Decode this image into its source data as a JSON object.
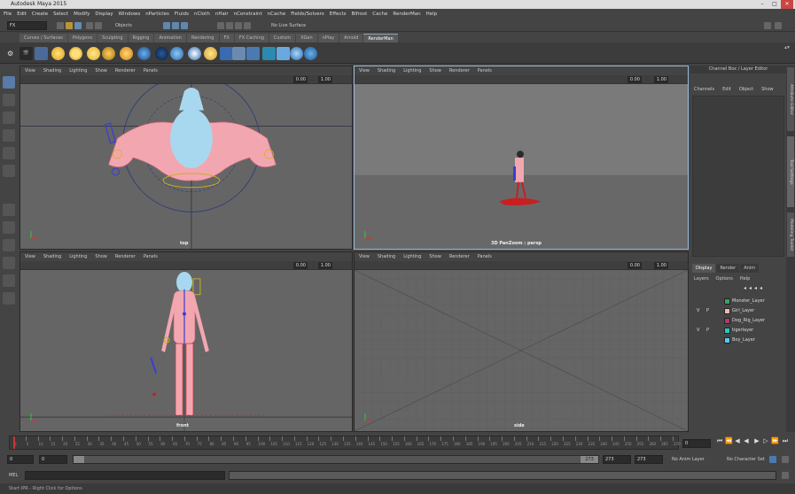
{
  "window": {
    "title": "Autodesk Maya 2015"
  },
  "menu": [
    "File",
    "Edit",
    "Create",
    "Select",
    "Modify",
    "Display",
    "Windows",
    "nParticles",
    "Fluids",
    "nCloth",
    "nHair",
    "nConstraint",
    "nCache",
    "Fields/Solvers",
    "Effects",
    "Bifrost",
    "Cache",
    "RenderMan",
    "Help"
  ],
  "status": {
    "mode": "FX",
    "objects": "Objects",
    "live": "No Live Surface"
  },
  "shelf_tabs": [
    "Curves / Surfaces",
    "Polygons",
    "Sculpting",
    "Rigging",
    "Animation",
    "Rendering",
    "FX",
    "FX Caching",
    "Custom",
    "XGen",
    "nPlay",
    "Arnold",
    "RenderMan"
  ],
  "shelf_active": "RenderMan",
  "viewport_menu": [
    "View",
    "Shading",
    "Lighting",
    "Show",
    "Renderer",
    "Panels"
  ],
  "viewports": {
    "top": {
      "label": "top",
      "near": "0.00",
      "far": "1.00"
    },
    "persp": {
      "label": "3D PanZoom : persp",
      "near": "0.00",
      "far": "1.00"
    },
    "front": {
      "label": "front",
      "near": "0.00",
      "far": "1.00"
    },
    "side": {
      "label": "side",
      "near": "0.00",
      "far": "1.00"
    }
  },
  "channel_box": {
    "title": "Channel Box / Layer Editor",
    "menu": [
      "Channels",
      "Edit",
      "Object",
      "Show"
    ]
  },
  "layer_editor": {
    "tabs": [
      "Display",
      "Render",
      "Anim"
    ],
    "menu": [
      "Layers",
      "Options",
      "Help"
    ],
    "layers": [
      {
        "vis": "",
        "p": "",
        "name": "Monster_Layer",
        "color": "#3aa06a"
      },
      {
        "vis": "V",
        "p": "P",
        "name": "Girl_Layer",
        "color": "#f2b6b6"
      },
      {
        "vis": "",
        "p": "",
        "name": "Dog_Rig_Layer",
        "color": "#b03a6a"
      },
      {
        "vis": "V",
        "p": "P",
        "name": "tigerlayer",
        "color": "#2ac8c8"
      },
      {
        "vis": "",
        "p": "",
        "name": "Boy_Layer",
        "color": "#5ac8f0"
      }
    ]
  },
  "side_tabs": [
    "Attribute Editor",
    "Tool Settings",
    "Modeling Toolkit"
  ],
  "time_slider": {
    "current": "0",
    "ticks": [
      "0",
      "5",
      "10",
      "15",
      "20",
      "25",
      "30",
      "35",
      "40",
      "45",
      "50",
      "55",
      "60",
      "65",
      "70",
      "75",
      "80",
      "85",
      "90",
      "95",
      "100",
      "105",
      "110",
      "115",
      "120",
      "125",
      "130",
      "135",
      "140",
      "145",
      "150",
      "155",
      "160",
      "165",
      "170",
      "175",
      "180",
      "185",
      "190",
      "195",
      "200",
      "205",
      "210",
      "215",
      "220",
      "225",
      "230",
      "235",
      "240",
      "245",
      "250",
      "255",
      "260",
      "265",
      "270"
    ]
  },
  "range": {
    "start": "0",
    "inner_start": "0",
    "inner_end": "273",
    "end": "273",
    "end2": "273",
    "anim_layer": "No Anim Layer",
    "char_set": "No Character Set"
  },
  "command": {
    "lang": "MEL"
  },
  "help": "Start IPR - Right Click for Options",
  "colors": {
    "active_border": "#99bbdd",
    "joint": "#3b3bd6",
    "skin": "#f2a7b0",
    "hair": "#a8d8f0"
  }
}
